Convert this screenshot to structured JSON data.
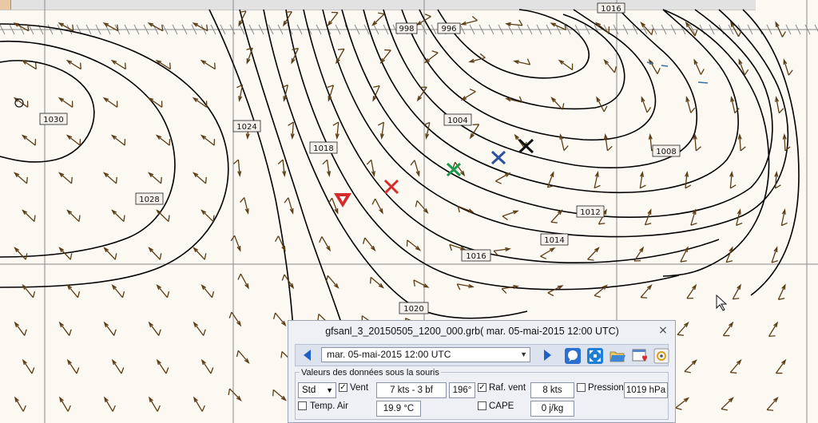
{
  "map": {
    "isobar_labels": [
      "998",
      "996",
      "1030",
      "1024",
      "1004",
      "1018",
      "1008",
      "1028",
      "1012",
      "1014",
      "1016",
      "1020",
      "1016"
    ],
    "marker_colors": {
      "red": "#d62b2b",
      "green": "#1b9a4a",
      "blue": "#2c4fa0",
      "black": "#111111"
    }
  },
  "panel": {
    "title": "gfsanl_3_20150505_1200_000.grb( mar. 05-mai-2015 12:00  UTC)",
    "close": "×",
    "date_select": "mar. 05-mai-2015 12:00  UTC",
    "group_title": "Valeurs des données sous la souris",
    "std_select": "Std",
    "vent_label": "Vent",
    "vent_value": "7 kts -  3 bf",
    "direction_value": "196°",
    "raf_label": "Raf. vent",
    "raf_value": "8 kts",
    "pression_label": "Pression",
    "pression_value": "1019 hPa",
    "temp_label": "Temp. Air",
    "temp_value": "19.9 °C",
    "cape_label": "CAPE",
    "cape_value": "0 j/kg",
    "vent_checked": "✓",
    "raf_checked": "✓"
  },
  "icons": [
    "prev-arrow-icon",
    "next-arrow-icon",
    "zoom-icon",
    "fit-icon",
    "open-file-icon",
    "favorites-icon",
    "settings-icon",
    "close-icon"
  ]
}
